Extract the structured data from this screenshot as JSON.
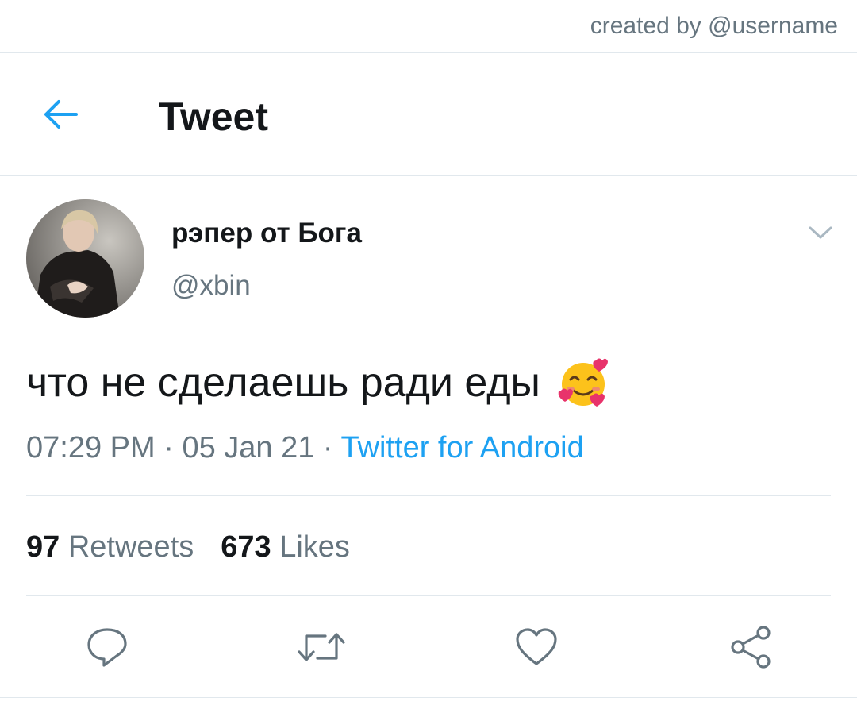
{
  "credit": "created by @username",
  "header": {
    "title": "Tweet"
  },
  "tweet": {
    "display_name": "рэпер от Бога",
    "handle": "@xbin",
    "text": "что не сделаешь ради еды",
    "emoji": "smiling-face-with-hearts-icon",
    "time": "07:29 PM",
    "date": "05 Jan 21",
    "separator": " · ",
    "source": "Twitter for Android"
  },
  "stats": {
    "retweets_count": "97",
    "retweets_label": "Retweets",
    "likes_count": "673",
    "likes_label": "Likes"
  },
  "colors": {
    "accent": "#1da1f2",
    "muted": "#66757f",
    "divider": "#e1e8ed",
    "text": "#14171a"
  },
  "icons": [
    "arrow-left-icon",
    "chevron-down-icon",
    "reply-icon",
    "retweet-icon",
    "like-icon",
    "share-icon"
  ]
}
